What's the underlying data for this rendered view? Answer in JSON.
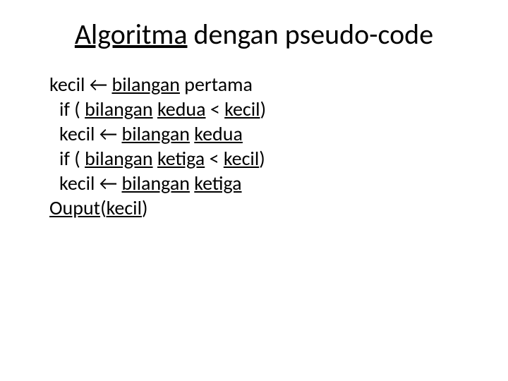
{
  "title": {
    "word_underlined": "Algoritma",
    "rest": " dengan pseudo-code"
  },
  "lines": {
    "l1a": "kecil ",
    "l1arrow": "←",
    "l1b_u": "bilangan",
    "l1c": " pertama",
    "l2a": "if ( ",
    "l2b_u": "bilangan",
    "l2c": " ",
    "l2d_u": "kedua",
    "l2e": " < ",
    "l2f_u": "kecil",
    "l2g": ")",
    "l3a": "kecil ",
    "l3arrow": "←",
    "l3b": " ",
    "l3c_u": "bilangan",
    "l3d": " ",
    "l3e_u": "kedua",
    "l4a": "if ( ",
    "l4b_u": "bilangan",
    "l4c": " ",
    "l4d_u": "ketiga",
    "l4e": " < ",
    "l4f_u": "kecil",
    "l4g": ")",
    "l5a": "kecil ",
    "l5arrow": "←",
    "l5b": " ",
    "l5c_u": "bilangan",
    "l5d": " ",
    "l5e_u": "ketiga",
    "l6a": "Ouput",
    "l6b": "(",
    "l6c_u": "kecil",
    "l6d": ")"
  }
}
